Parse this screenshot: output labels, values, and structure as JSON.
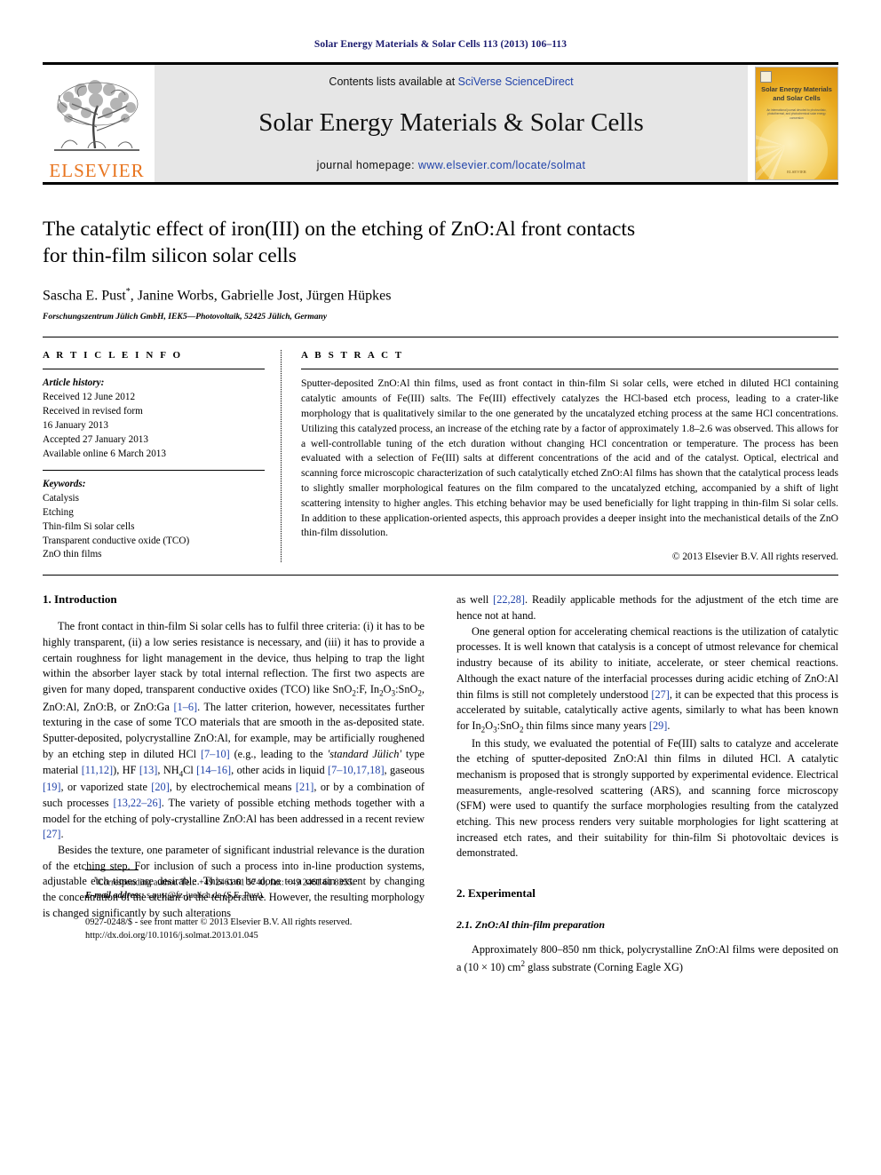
{
  "running_head": "Solar Energy Materials & Solar Cells 113 (2013) 106–113",
  "masthead": {
    "elsevier_wordmark": "ELSEVIER",
    "contents_prefix": "Contents lists available at ",
    "contents_link": "SciVerse ScienceDirect",
    "journal_title": "Solar Energy Materials & Solar Cells",
    "homepage_prefix": "journal homepage: ",
    "homepage_url": "www.elsevier.com/locate/solmat",
    "cover": {
      "title_line1": "Solar Energy Materials",
      "title_line2": "and Solar Cells",
      "subtitle": "An international journal devoted to photovoltaic, photothermal, and photochemical solar energy conversion",
      "publisher": "ELSEVIER"
    }
  },
  "article": {
    "title_line1": "The catalytic effect of iron(III) on the etching of ZnO:Al front contacts",
    "title_line2": "for thin-film silicon solar cells",
    "authors": "Sascha E. Pust",
    "authors_rest": ", Janine Worbs, Gabrielle Jost, Jürgen Hüpkes",
    "corresponding_marker": "*",
    "affiliation": "Forschungszentrum Jülich GmbH, IEK5—Photovoltaik, 52425 Jülich, Germany"
  },
  "article_info": {
    "heading": "A R T I C L E   I N F O",
    "history_label": "Article history:",
    "history": [
      "Received 12 June 2012",
      "Received in revised form",
      "16 January 2013",
      "Accepted 27 January 2013",
      "Available online 6 March 2013"
    ],
    "keywords_label": "Keywords:",
    "keywords": [
      "Catalysis",
      "Etching",
      "Thin-film Si solar cells",
      "Transparent conductive oxide (TCO)",
      "ZnO thin films"
    ]
  },
  "abstract": {
    "heading": "A B S T R A C T",
    "text": "Sputter-deposited ZnO:Al thin films, used as front contact in thin-film Si solar cells, were etched in diluted HCl containing catalytic amounts of Fe(III) salts. The Fe(III) effectively catalyzes the HCl-based etch process, leading to a crater-like morphology that is qualitatively similar to the one generated by the uncatalyzed etching process at the same HCl concentrations. Utilizing this catalyzed process, an increase of the etching rate by a factor of approximately 1.8–2.6 was observed. This allows for a well-controllable tuning of the etch duration without changing HCl concentration or temperature. The process has been evaluated with a selection of Fe(III) salts at different concentrations of the acid and of the catalyst. Optical, electrical and scanning force microscopic characterization of such catalytically etched ZnO:Al films has shown that the catalytical process leads to slightly smaller morphological features on the film compared to the uncatalyzed etching, accompanied by a shift of light scattering intensity to higher angles. This etching behavior may be used beneficially for light trapping in thin-film Si solar cells. In addition to these application-oriented aspects, this approach provides a deeper insight into the mechanistical details of the ZnO thin-film dissolution.",
    "copyright": "© 2013 Elsevier B.V. All rights reserved."
  },
  "sections": {
    "introduction": {
      "heading": "1.  Introduction",
      "p1_a": "The front contact in thin-film Si solar cells has to fulfil three criteria: (i) it has to be highly transparent, (ii) a low series resistance is necessary, and (iii) it has to provide a certain roughness for light management in the device, thus helping to trap the light within the absorber layer stack by total internal reflection. The first two aspects are given for many doped, transparent conductive oxides (TCO) like SnO",
      "p1_refs1": "[1–6]",
      "p1_b": ". The latter criterion, however, necessitates further texturing in the case of some TCO materials that are smooth in the as-deposited state. Sputter-deposited, polycrystalline ZnO:Al, for example, may be artificially roughened by an etching step in diluted HCl ",
      "p1_r2": "[7–10]",
      "p1_c": " (e.g., leading to the ",
      "p1_italic": "'standard Jülich'",
      "p1_d": " type material ",
      "p1_r3": "[11,12]",
      "p1_e": "), HF ",
      "p1_r4": "[13]",
      "p1_f": ", NH",
      "p1_g": "Cl ",
      "p1_r5": "[14–16]",
      "p1_h": ", other acids in liquid ",
      "p1_r6": "[7–10,17,18]",
      "p1_i": ", gaseous ",
      "p1_r7": "[19]",
      "p1_j": ", or vaporized state ",
      "p1_r8": "[20]",
      "p1_k": ", by electrochemical means ",
      "p1_r9": "[21]",
      "p1_l": ", or by a combination of such processes ",
      "p1_r10": "[13,22–26]",
      "p1_m": ". The variety of possible etching methods together with a model for the etching of poly-crystalline ZnO:Al has been addressed in a recent review ",
      "p1_r11": "[27]",
      "p1_n": ".",
      "p2": "Besides the texture, one parameter of significant industrial relevance is the duration of the etching step. For inclusion of such a process into in-line production systems, adjustable etch times are desirable. This can be done to a certain extent by changing the concentration of the etchant or the temperature. However, the resulting morphology is changed significantly by such alterations",
      "p3_a": "as well ",
      "p3_r1": "[22,28]",
      "p3_b": ". Readily applicable methods for the adjustment of the etch time are hence not at hand.",
      "p4_a": "One general option for accelerating chemical reactions is the utilization of catalytic processes. It is well known that catalysis is a concept of utmost relevance for chemical industry because of its ability to initiate, accelerate, or steer chemical reactions. Although the exact nature of the interfacial processes during acidic etching of ZnO:Al thin films is still not completely understood ",
      "p4_r1": "[27]",
      "p4_b": ", it can be expected that this process is accelerated by suitable, catalytically active agents, similarly to what has been known for In",
      "p4_c": " thin films since many years ",
      "p4_r2": "[29]",
      "p4_d": ".",
      "p5": "In this study, we evaluated the potential of Fe(III) salts to catalyze and accelerate the etching of sputter-deposited ZnO:Al thin films in diluted HCl. A catalytic mechanism is proposed that is strongly supported by experimental evidence. Electrical measurements, angle-resolved scattering (ARS), and scanning force microscopy (SFM) were used to quantify the surface morphologies resulting from the catalyzed etching. This new process renders very suitable morphologies for light scattering at increased etch rates, and their suitability for thin-film Si photovoltaic devices is demonstrated."
    },
    "experimental": {
      "heading": "2.  Experimental",
      "subheading": "2.1.  ZnO:Al thin-film preparation",
      "p1_a": "Approximately  800–850 nm  thick,  polycrystalline  ZnO:Al  films were deposited on a (10 × 10)  cm",
      "p1_b": " glass substrate (Corning Eagle XG)"
    }
  },
  "footnote": {
    "marker": "*",
    "text": "Corresponding author. Tel.: +49 2461 61 5740; fax: +49 2461 61 8355.",
    "email_label": "E-mail address:",
    "email": "s.pust@fz-juelich.de (S.E. Pust)."
  },
  "footer": {
    "issn_line": "0927-0248/$ - see front matter © 2013 Elsevier B.V. All rights reserved.",
    "doi_line": "http://dx.doi.org/10.1016/j.solmat.2013.01.045"
  },
  "colors": {
    "link_blue": "#2244aa",
    "running_head_navy": "#1a1a6e",
    "elsevier_orange": "#E8741E",
    "band_grey": "#e6e6e6"
  }
}
